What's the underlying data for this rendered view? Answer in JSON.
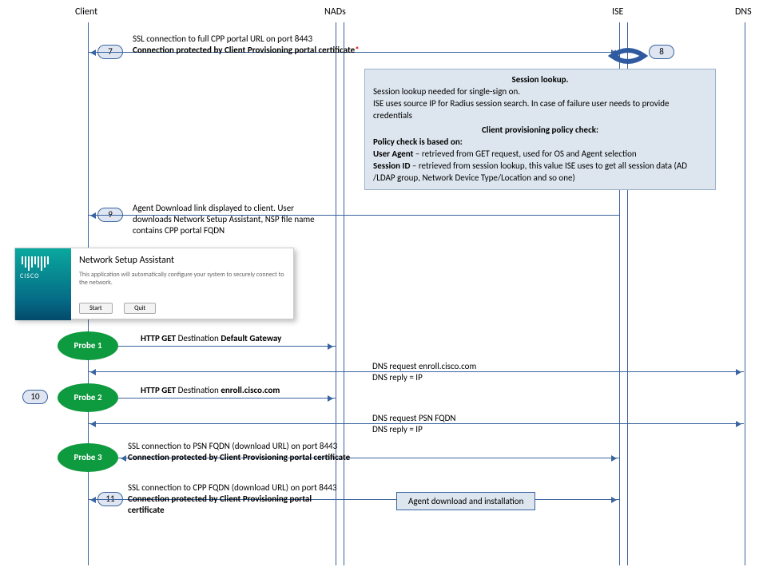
{
  "headers": {
    "client": "Client",
    "nads": "NADs",
    "ise": "ISE",
    "dns": "DNS"
  },
  "steps": {
    "s7": "7",
    "s8": "8",
    "s9": "9",
    "s10": "10",
    "s11": "11"
  },
  "msg7": {
    "l1": "SSL connection to full CPP portal URL on port 8443",
    "l2": "Connection protected by Client Provisioning  portal certificate",
    "star": "*"
  },
  "panel": {
    "t1": "Session lookup.",
    "p1": "Session lookup needed for single-sign on.",
    "p2": "ISE uses source IP for Radius session search. In case of failure user needs to provide credentials",
    "t2": "Client provisioning policy check:",
    "p3": "Policy check is based on:",
    "p4a": "User Agent",
    "p4b": " – retrieved from GET request, used for OS and Agent selection",
    "p5a": "Session ID",
    "p5b": " – retrieved from session lookup, this value ISE uses to get all session data (AD /LDAP group, Network Device Type/Location and so one)"
  },
  "msg9": {
    "l1": "Agent Download link displayed to client. User",
    "l2": "downloads Network Setup Assistant, NSP file name",
    "l3": "contains CPP portal FQDN"
  },
  "nsa": {
    "brand": "CISCO",
    "title": "Network Setup Assistant",
    "desc": "This application will automatically configure your system to securely connect to the network.",
    "start": "Start",
    "quit": "Quit"
  },
  "probes": {
    "p1": "Probe 1",
    "p2": "Probe 2",
    "p3": "Probe 3"
  },
  "probe1": {
    "a": "HTTP GET ",
    "b": "Destination ",
    "c": "Default Gateway"
  },
  "dns1": {
    "l1": "DNS request enroll.cisco.com",
    "l2": "DNS reply = IP"
  },
  "probe2": {
    "a": "HTTP GET ",
    "b": "Destination ",
    "c": "enroll.cisco.com"
  },
  "dns2": {
    "l1": "DNS request PSN FQDN",
    "l2": "DNS reply = IP"
  },
  "probe3": {
    "l1": "SSL connection to PSN FQDN (download URL) on port 8443",
    "l2": "Connection protected by Client Provisioning  portal certificate"
  },
  "msg11": {
    "l1": "SSL connection to CPP FQDN (download URL) on port 8443",
    "l2": "Connection protected by Client Provisioning  portal",
    "l3": "certificate"
  },
  "agent": "Agent download and installation"
}
